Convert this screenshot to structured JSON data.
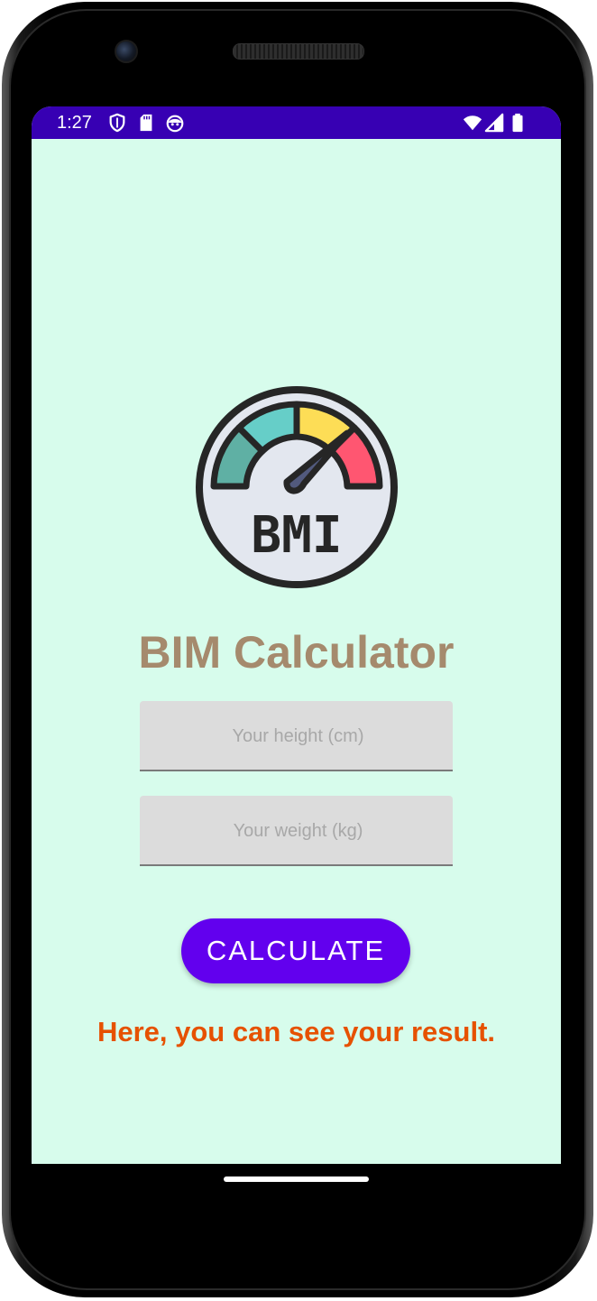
{
  "status_bar": {
    "time": "1:27",
    "left_icons": [
      "shield-icon",
      "sd-card-icon",
      "android-face-icon"
    ],
    "right_icons": [
      "wifi-icon",
      "signal-icon",
      "battery-icon"
    ],
    "background_color": "#3700b3"
  },
  "app": {
    "logo_text": "BMI",
    "title": "BIM Calculator",
    "height_placeholder": "Your height (cm)",
    "weight_placeholder": "Your weight (kg)",
    "calculate_label": "CALCULATE",
    "result_text": "Here, you can see your result.",
    "background_color": "#d7fcec",
    "title_color": "#a58a6d",
    "button_color": "#6200ee",
    "result_color": "#e65100"
  }
}
